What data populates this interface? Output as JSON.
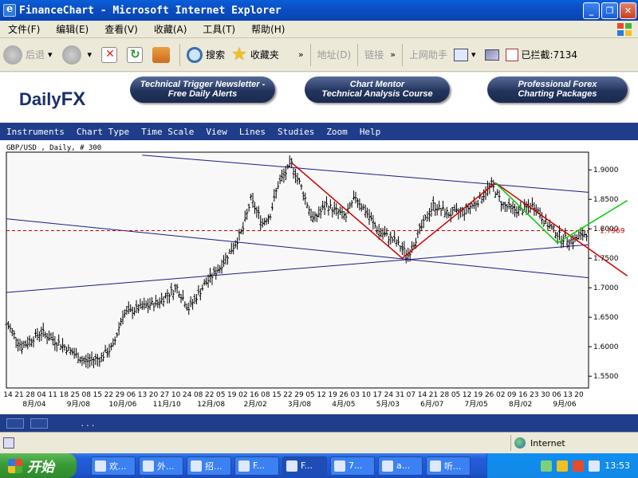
{
  "window": {
    "title": "FinanceChart - Microsoft Internet Explorer"
  },
  "menu": [
    "文件(F)",
    "编辑(E)",
    "查看(V)",
    "收藏(A)",
    "工具(T)",
    "帮助(H)"
  ],
  "toolbar": {
    "back": "后退",
    "search": "搜索",
    "favorites": "收藏夹",
    "address": "地址(D)",
    "links": "链接",
    "helper": "上网助手",
    "blocked": "已拦截:7134"
  },
  "site": {
    "logo_a": "Daily",
    "logo_b": "FX",
    "promo1": [
      "Technical Trigger Newsletter -",
      "Free Daily Alerts"
    ],
    "promo2": [
      "Chart Mentor",
      "Technical Analysis Course"
    ],
    "promo3": [
      "Professional Forex",
      "Charting Packages"
    ],
    "nav": [
      "Instruments",
      "Chart Type",
      "Time Scale",
      "View",
      "Lines",
      "Studies",
      "Zoom",
      "Help"
    ]
  },
  "chart_data": {
    "type": "bar",
    "subtype": "ohlc",
    "title": "GBP/USD , Daily, # 300",
    "ylim": [
      1.53,
      1.93
    ],
    "y_ticks": [
      1.55,
      1.6,
      1.65,
      1.7,
      1.75,
      1.8,
      1.85,
      1.9
    ],
    "y_tick_labels": [
      "1.5500",
      "1.6000",
      "1.6500",
      "1.7000",
      "1.7500",
      "1.8000",
      "1.8500",
      "1.9000"
    ],
    "current_price": 1.7969,
    "current_price_label": "1.7969",
    "x_day_labels": [
      "14",
      "21",
      "28",
      "04",
      "11",
      "18",
      "25",
      "08",
      "15",
      "22",
      "29",
      "06",
      "13",
      "20",
      "27",
      "10",
      "24",
      "08",
      "22",
      "05",
      "19",
      "02",
      "16",
      "08",
      "15",
      "22",
      "29",
      "05",
      "12",
      "19",
      "26",
      "03",
      "10",
      "17",
      "24",
      "31",
      "07",
      "14",
      "21",
      "28",
      "05",
      "12",
      "19",
      "26",
      "02",
      "09",
      "16",
      "23",
      "30",
      "06",
      "13",
      "20"
    ],
    "x_month_labels": [
      "8月/04",
      "9月/08",
      "10月/06",
      "11月/10",
      "12月/08",
      "2月/02",
      "3月/08",
      "4月/05",
      "5月/03",
      "6月/07",
      "7月/05",
      "8月/02",
      "9月/06"
    ],
    "x_range": [
      0,
      300
    ],
    "price_path": [
      [
        0,
        1.64
      ],
      [
        8,
        1.6
      ],
      [
        18,
        1.625
      ],
      [
        30,
        1.6
      ],
      [
        40,
        1.575
      ],
      [
        48,
        1.58
      ],
      [
        55,
        1.6
      ],
      [
        60,
        1.655
      ],
      [
        68,
        1.665
      ],
      [
        78,
        1.675
      ],
      [
        88,
        1.7
      ],
      [
        94,
        1.665
      ],
      [
        102,
        1.705
      ],
      [
        110,
        1.735
      ],
      [
        118,
        1.775
      ],
      [
        122,
        1.8
      ],
      [
        126,
        1.85
      ],
      [
        132,
        1.81
      ],
      [
        136,
        1.825
      ],
      [
        140,
        1.875
      ],
      [
        147,
        1.91
      ],
      [
        152,
        1.87
      ],
      [
        158,
        1.815
      ],
      [
        165,
        1.84
      ],
      [
        175,
        1.82
      ],
      [
        180,
        1.855
      ],
      [
        186,
        1.825
      ],
      [
        192,
        1.795
      ],
      [
        200,
        1.78
      ],
      [
        207,
        1.755
      ],
      [
        212,
        1.79
      ],
      [
        220,
        1.84
      ],
      [
        228,
        1.825
      ],
      [
        236,
        1.83
      ],
      [
        244,
        1.85
      ],
      [
        250,
        1.875
      ],
      [
        256,
        1.84
      ],
      [
        264,
        1.83
      ],
      [
        272,
        1.84
      ],
      [
        278,
        1.81
      ],
      [
        286,
        1.785
      ],
      [
        292,
        1.78
      ],
      [
        300,
        1.795
      ]
    ],
    "channel_upper": [
      [
        70,
        1.925
      ],
      [
        300,
        1.862
      ]
    ],
    "channel_lower": [
      [
        0,
        1.817
      ],
      [
        300,
        1.717
      ]
    ],
    "support_lower": [
      [
        0,
        1.692
      ],
      [
        300,
        1.773
      ]
    ],
    "red_segments": [
      [
        [
          147,
          1.912
        ],
        [
          204,
          1.75
        ]
      ],
      [
        [
          204,
          1.75
        ],
        [
          252,
          1.878
        ]
      ],
      [
        [
          252,
          1.878
        ],
        [
          320,
          1.72
        ]
      ]
    ],
    "green_segments": [
      [
        [
          252,
          1.878
        ],
        [
          284,
          1.776
        ]
      ],
      [
        [
          284,
          1.776
        ],
        [
          320,
          1.848
        ]
      ]
    ],
    "colors": {
      "up": "#000000",
      "channel": "#1a1a8c",
      "trend": "#cc0000",
      "forecast": "#00cc00",
      "price_line": "#cc0000"
    }
  },
  "status": {
    "zone": "Internet",
    "dots": "..."
  },
  "taskbar": {
    "start": "开始",
    "tasks": [
      "欢...",
      "外...",
      "招...",
      "F...",
      "F...",
      "7...",
      "a...",
      "听..."
    ],
    "clock": "13:53"
  }
}
